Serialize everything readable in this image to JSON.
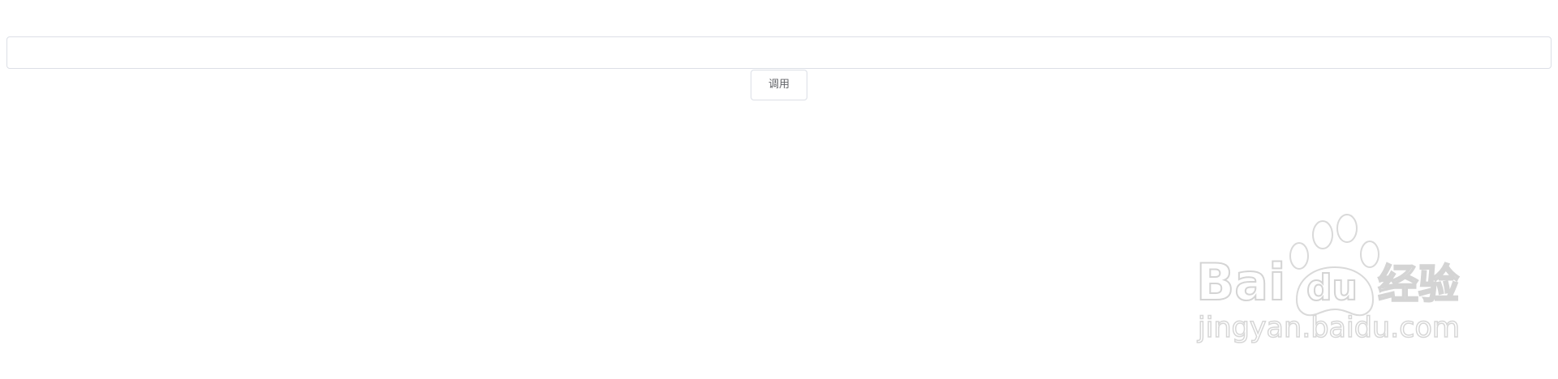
{
  "form": {
    "input_value": "",
    "input_placeholder": "",
    "button_label": "调用"
  },
  "watermark": {
    "logo_text": "Bai du 经验",
    "site_text": "jingyan.baidu.com"
  }
}
